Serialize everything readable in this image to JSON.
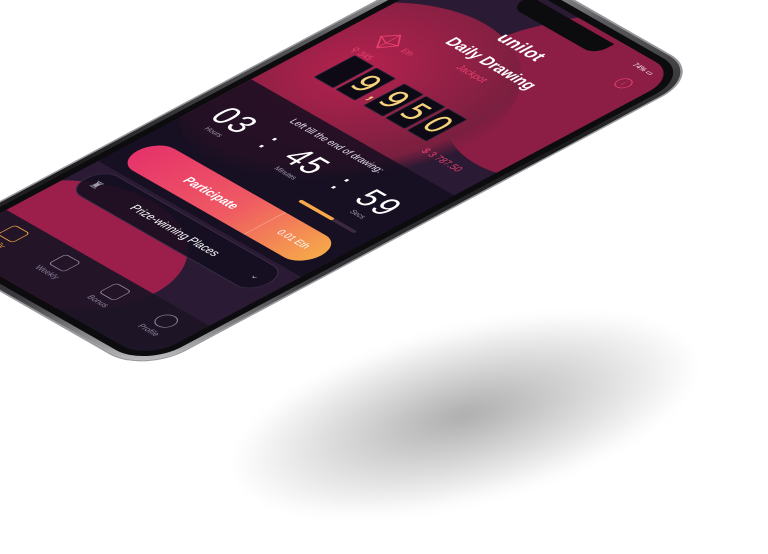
{
  "app": {
    "logo": "unilot",
    "title": "Daily Drawing",
    "jackpot_label": "Jackpot"
  },
  "status_bar": {
    "signal": "••••",
    "battery": "74% ▭"
  },
  "header": {
    "menu_icon": "hamburger-icon",
    "info_icon": "info-icon",
    "info_glyph": "i"
  },
  "jackpot": {
    "currency_label": "Eth",
    "users_count": "345",
    "digits": [
      "",
      "9",
      ",",
      "9",
      "5",
      "0"
    ],
    "usd_value": "$ 3 787.50"
  },
  "timer": {
    "label": "Left till the end of drawing:",
    "hours": "03",
    "minutes": "45",
    "seconds": "59",
    "hours_unit": "Hours",
    "minutes_unit": "Minutes",
    "seconds_unit": "Secs",
    "separator": ":",
    "progress": 0.6
  },
  "participate": {
    "label": "Participate",
    "price": "0.01 Eth"
  },
  "prize": {
    "label": "Prize-winning Places"
  },
  "tabbar": {
    "tabs": [
      {
        "label": "Daily",
        "icon": "calendar-icon",
        "active": true
      },
      {
        "label": "Weekly",
        "icon": "calendar-week-icon",
        "active": false
      },
      {
        "label": "Bonus",
        "icon": "gift-icon",
        "active": false
      },
      {
        "label": "Profile",
        "icon": "profile-icon",
        "active": false
      }
    ]
  },
  "colors": {
    "accent": "#e9416e",
    "gold": "#f6d27a",
    "orange": "#f6a84a",
    "background": "#2a1a33"
  }
}
